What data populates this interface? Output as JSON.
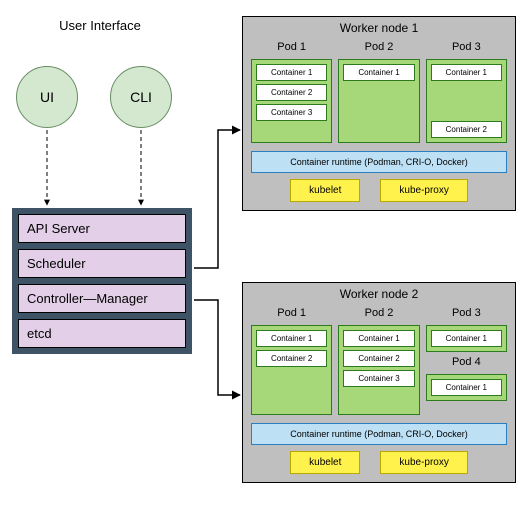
{
  "user_interface": {
    "title": "User Interface",
    "ui_label": "UI",
    "cli_label": "CLI"
  },
  "control_plane": {
    "api_server": "API Server",
    "scheduler": "Scheduler",
    "controller_manager": "Controller—Manager",
    "etcd": "etcd"
  },
  "workers": [
    {
      "title": "Worker node 1",
      "pods": [
        {
          "title": "Pod 1",
          "containers": [
            "Container 1",
            "Container 2",
            "Container 3"
          ]
        },
        {
          "title": "Pod 2",
          "containers": [
            "Container 1"
          ]
        },
        {
          "title": "Pod 3",
          "containers": [
            "Container 1",
            "Container 2"
          ]
        }
      ],
      "runtime": "Container runtime (Podman, CRI-O, Docker)",
      "services": {
        "kubelet": "kubelet",
        "kube_proxy": "kube-proxy"
      }
    },
    {
      "title": "Worker node 2",
      "pods_layout": [
        {
          "col": 0,
          "title": "Pod 1",
          "containers": [
            "Container 1",
            "Container 2"
          ]
        },
        {
          "col": 1,
          "title": "Pod 2",
          "containers": [
            "Container 1",
            "Container 2",
            "Container 3"
          ]
        },
        {
          "col": 2,
          "title": "Pod 3",
          "containers": [
            "Container 1"
          ]
        },
        {
          "col": 2,
          "title": "Pod 4",
          "containers": [
            "Container 1"
          ]
        }
      ],
      "runtime": "Container runtime (Podman, CRI-O, Docker)",
      "services": {
        "kubelet": "kubelet",
        "kube_proxy": "kube-proxy"
      }
    }
  ]
}
